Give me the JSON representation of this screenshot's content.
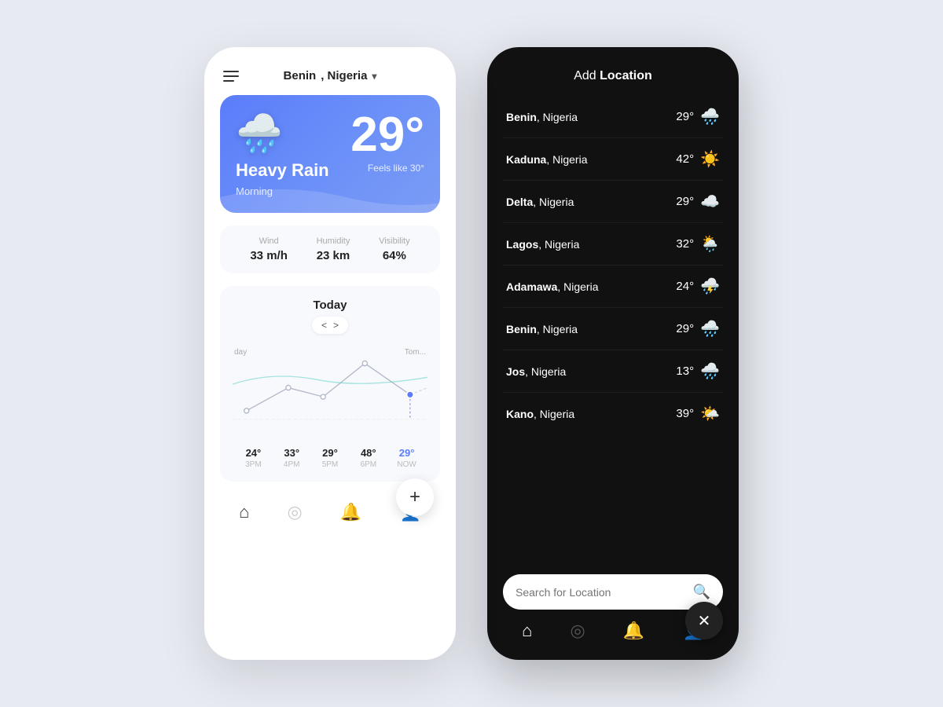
{
  "left_phone": {
    "header": {
      "location": "Benin",
      "country": ", Nigeria",
      "chevron": "▾"
    },
    "weather_card": {
      "temperature": "29°",
      "feels_like": "Feels like 30°",
      "condition": "Heavy Rain",
      "period": "Morning"
    },
    "stats": {
      "wind_label": "Wind",
      "wind_value": "33 m/h",
      "humidity_label": "Humidity",
      "humidity_value": "23 km",
      "visibility_label": "Visibility",
      "visibility_value": "64%"
    },
    "chart": {
      "title": "Today",
      "nav_prev": "<",
      "nav_next": ">",
      "day_labels": [
        "day",
        "Tom..."
      ],
      "points": [
        {
          "temp": "24°",
          "time": "3PM"
        },
        {
          "temp": "33°",
          "time": "4PM"
        },
        {
          "temp": "29°",
          "time": "5PM"
        },
        {
          "temp": "48°",
          "time": "6PM"
        },
        {
          "temp": "29°",
          "time": "NOW",
          "highlight": true
        }
      ]
    },
    "nav": {
      "home": "⌂",
      "location": "◎",
      "bell": "🔔",
      "user": "👤",
      "fab": "+"
    }
  },
  "right_phone": {
    "header": {
      "add_label": "Add ",
      "location_label": "Location"
    },
    "locations": [
      {
        "city": "Benin",
        "country": ", Nigeria",
        "temp": "29°",
        "icon": "🌧️"
      },
      {
        "city": "Kaduna",
        "country": ", Nigeria",
        "temp": "42°",
        "icon": "☀️"
      },
      {
        "city": "Delta",
        "country": ", Nigeria",
        "temp": "29°",
        "icon": "☁️"
      },
      {
        "city": "Lagos",
        "country": ", Nigeria",
        "temp": "32°",
        "icon": "🌦️"
      },
      {
        "city": "Adamawa",
        "country": ", Nigeria",
        "temp": "24°",
        "icon": "⛈️"
      },
      {
        "city": "Benin",
        "country": ", Nigeria",
        "temp": "29°",
        "icon": "🌧️"
      },
      {
        "city": "Jos",
        "country": ", Nigeria",
        "temp": "13°",
        "icon": "🌧️"
      },
      {
        "city": "Kano",
        "country": ", Nigeria",
        "temp": "39°",
        "icon": "🌤️"
      }
    ],
    "search": {
      "placeholder": "Search for Location"
    },
    "nav": {
      "home": "⌂",
      "location": "◎",
      "bell": "🔔",
      "user": "👤",
      "close": "✕"
    }
  }
}
